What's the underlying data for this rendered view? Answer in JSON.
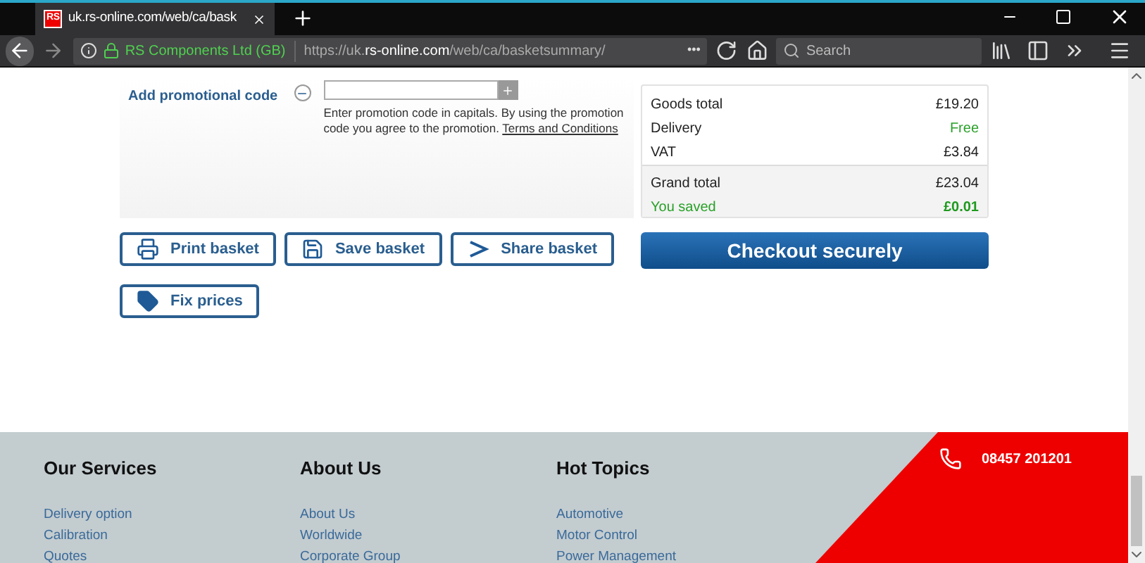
{
  "browser": {
    "tab": {
      "title": "uk.rs-online.com/web/ca/bask",
      "favicon": "RS"
    },
    "identity": "RS Components Ltd (GB)",
    "url": {
      "prefix": "https://uk.",
      "domain": "rs-online.com",
      "path": "/web/ca/basketsummary/"
    },
    "search": {
      "placeholder": "Search"
    },
    "more": "•••"
  },
  "promo": {
    "label": "Add promotional code",
    "expanded": true,
    "help": "Enter promotion code in capitals. By using the promotion code you agree to the promotion.",
    "link": "Terms and Conditions"
  },
  "summary": {
    "rows": [
      {
        "label": "Goods total",
        "value": "£19.20",
        "kind": "normal"
      },
      {
        "label": "Delivery",
        "value": "Free",
        "kind": "green"
      },
      {
        "label": "VAT",
        "value": "£3.84",
        "kind": "normal"
      }
    ],
    "totals": [
      {
        "label": "Grand total",
        "value": "£23.04",
        "kind": "normal"
      },
      {
        "label": "You saved",
        "value": "£0.01",
        "kind": "saved"
      }
    ]
  },
  "actions": [
    {
      "label": "Print basket",
      "kind": "print"
    },
    {
      "label": "Save basket",
      "kind": "save"
    },
    {
      "label": "Share basket",
      "kind": "share"
    },
    {
      "label": "Fix prices",
      "kind": "tag"
    }
  ],
  "checkout": "Checkout securely",
  "footer": {
    "columns": [
      {
        "title": "Our Services",
        "links": [
          "Delivery option",
          "Calibration",
          "Quotes"
        ]
      },
      {
        "title": "About Us",
        "links": [
          "About Us",
          "Worldwide",
          "Corporate Group"
        ]
      },
      {
        "title": "Hot Topics",
        "links": [
          "Automotive",
          "Motor Control",
          "Power Management"
        ]
      }
    ],
    "phone": "08457 201201"
  }
}
